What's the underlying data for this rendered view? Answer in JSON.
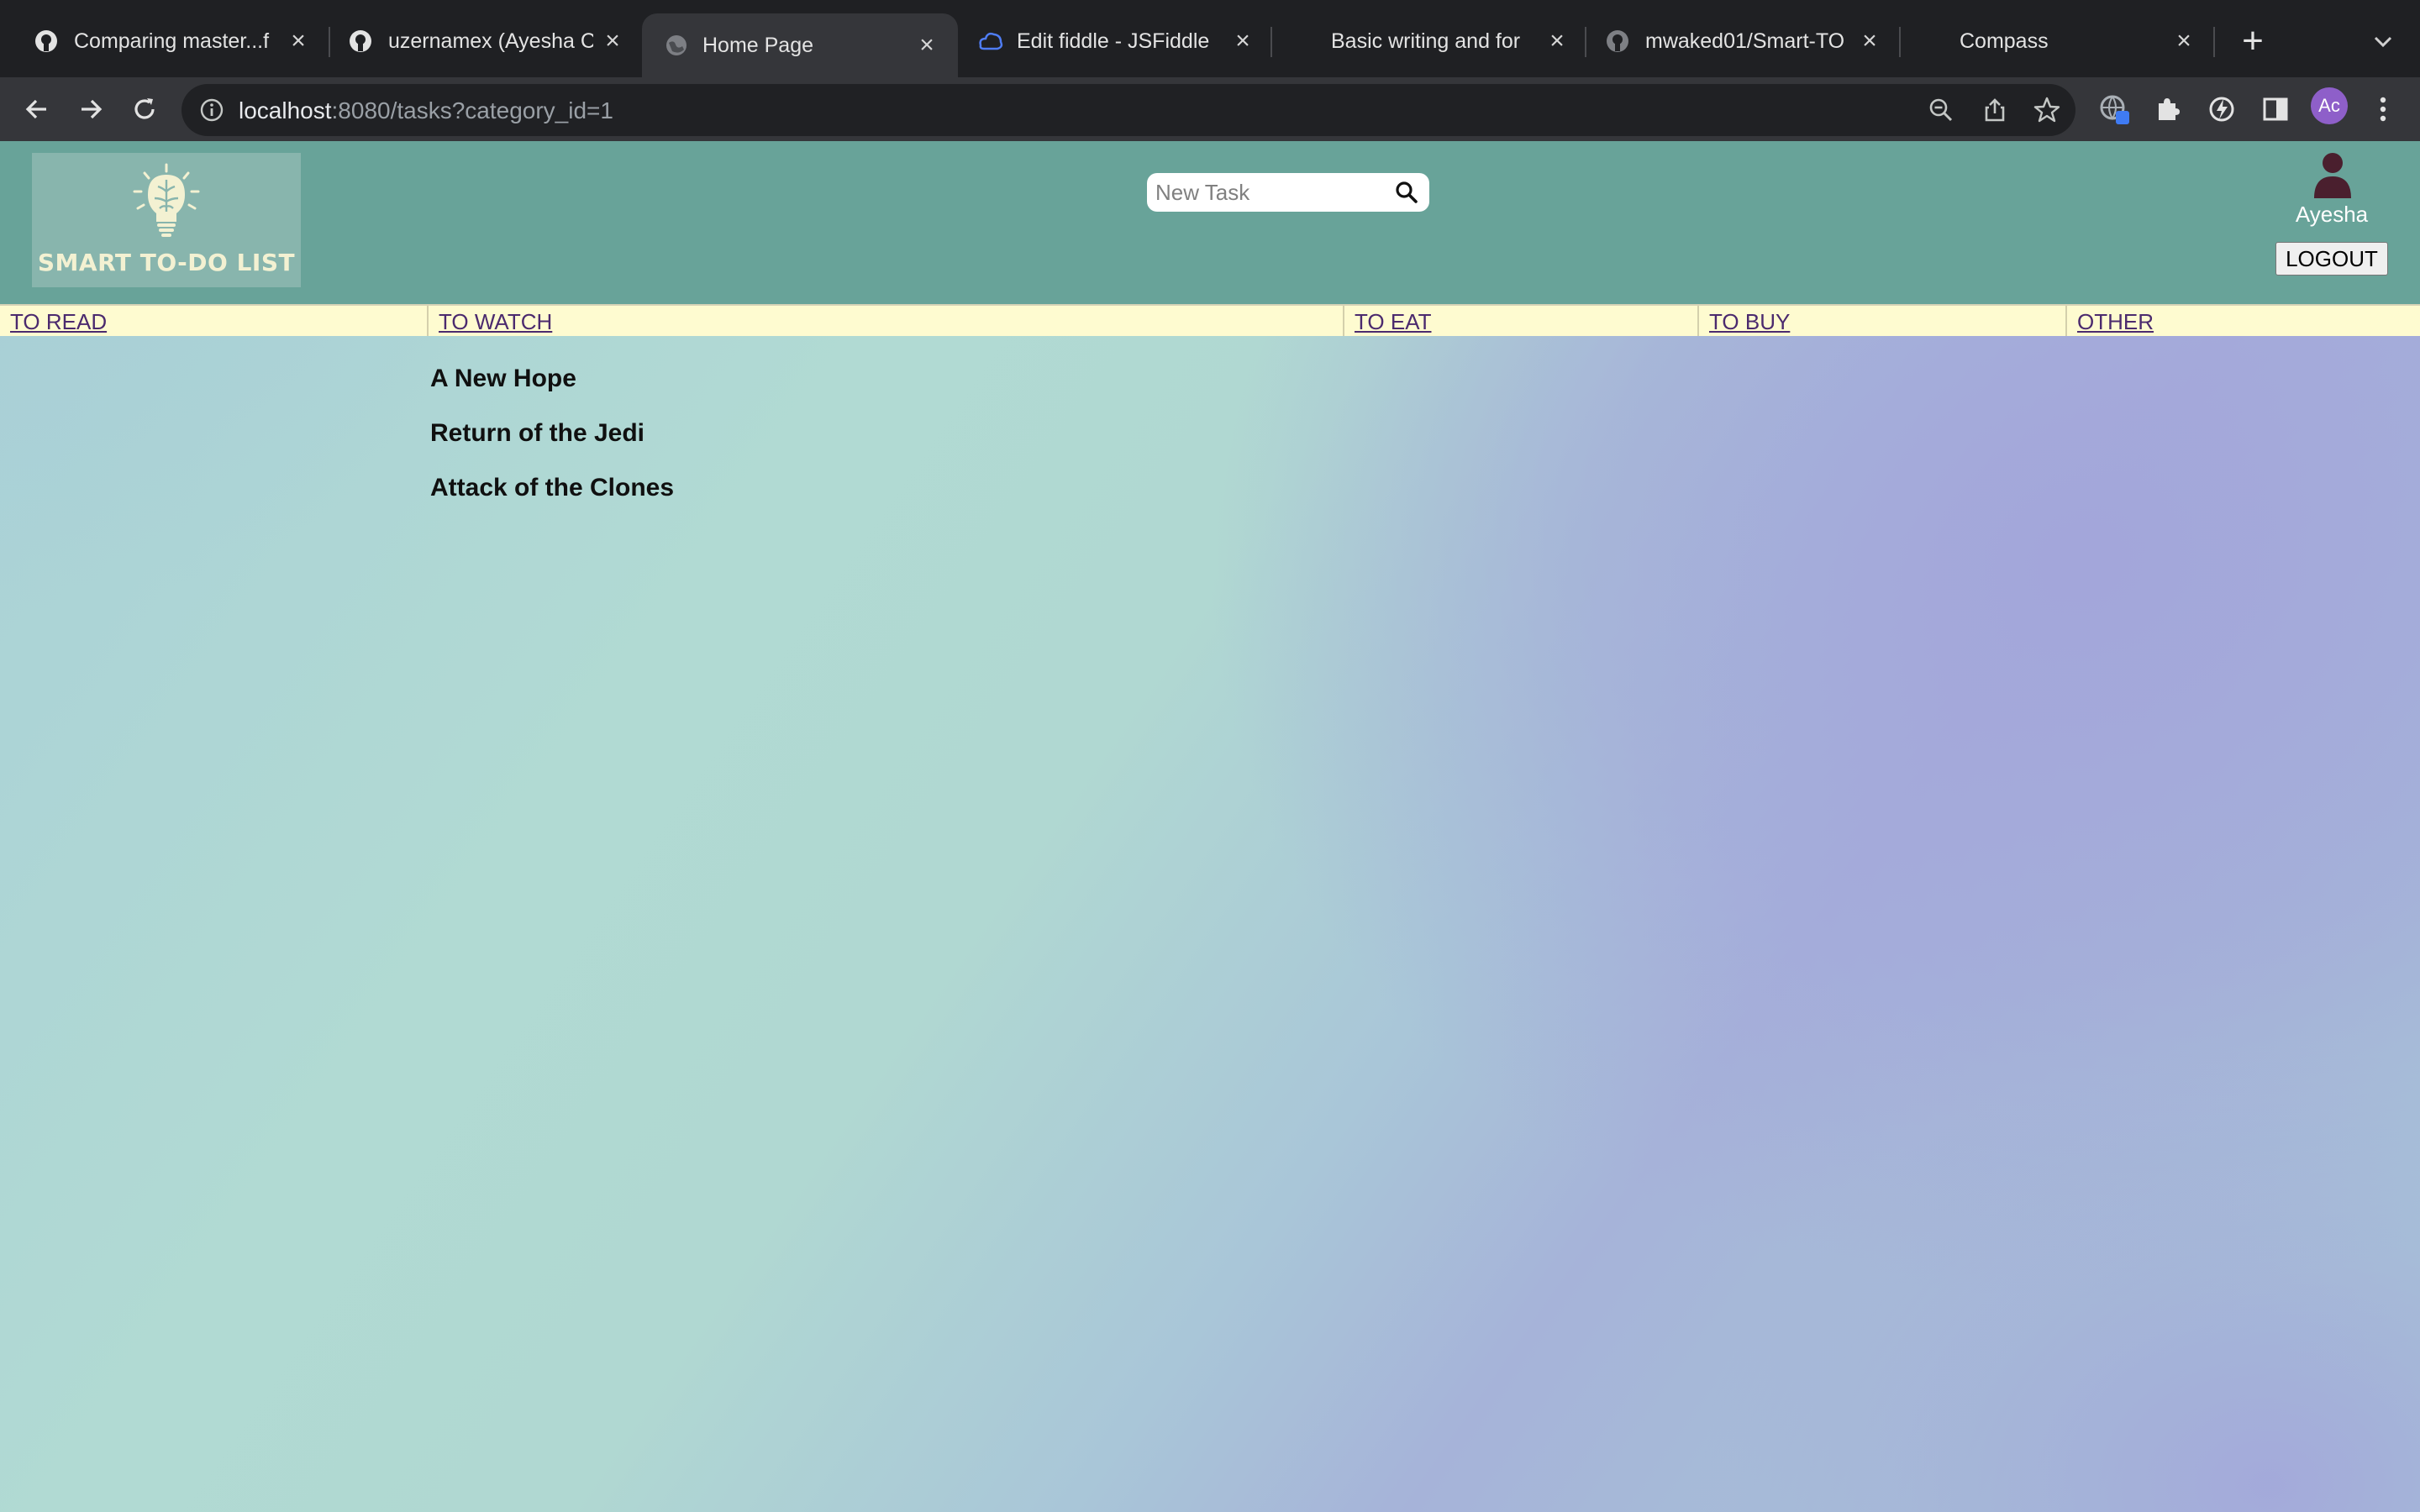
{
  "browser": {
    "tabs": [
      {
        "title": "Comparing master...f",
        "favicon": "github-icon",
        "active": false
      },
      {
        "title": "uzernamex (Ayesha C",
        "favicon": "github-icon",
        "active": false
      },
      {
        "title": "Home Page",
        "favicon": "globe-icon",
        "active": true
      },
      {
        "title": "Edit fiddle - JSFiddle",
        "favicon": "jsfiddle-icon",
        "active": false
      },
      {
        "title": "Basic writing and for",
        "favicon": "",
        "active": false
      },
      {
        "title": "mwaked01/Smart-TO",
        "favicon": "github-icon",
        "active": false
      },
      {
        "title": "Compass",
        "favicon": "",
        "active": false
      }
    ],
    "url_host": "localhost",
    "url_rest": ":8080/tasks?category_id=1",
    "profile_initials": "Ac"
  },
  "header": {
    "logo_text": "SMART TO-DO LIST",
    "search_placeholder": "New Task",
    "username": "Ayesha",
    "logout_label": "LOGOUT"
  },
  "categories": [
    {
      "label": "TO READ"
    },
    {
      "label": "TO WATCH"
    },
    {
      "label": "TO EAT"
    },
    {
      "label": "TO BUY"
    },
    {
      "label": "OTHER"
    }
  ],
  "tasks": [
    {
      "title": "A New Hope"
    },
    {
      "title": "Return of the Jedi"
    },
    {
      "title": "Attack of the Clones"
    }
  ],
  "colors": {
    "header_bg": "#68a399",
    "category_bar_bg": "#fefbd0",
    "link_color": "#4b2a6e"
  }
}
